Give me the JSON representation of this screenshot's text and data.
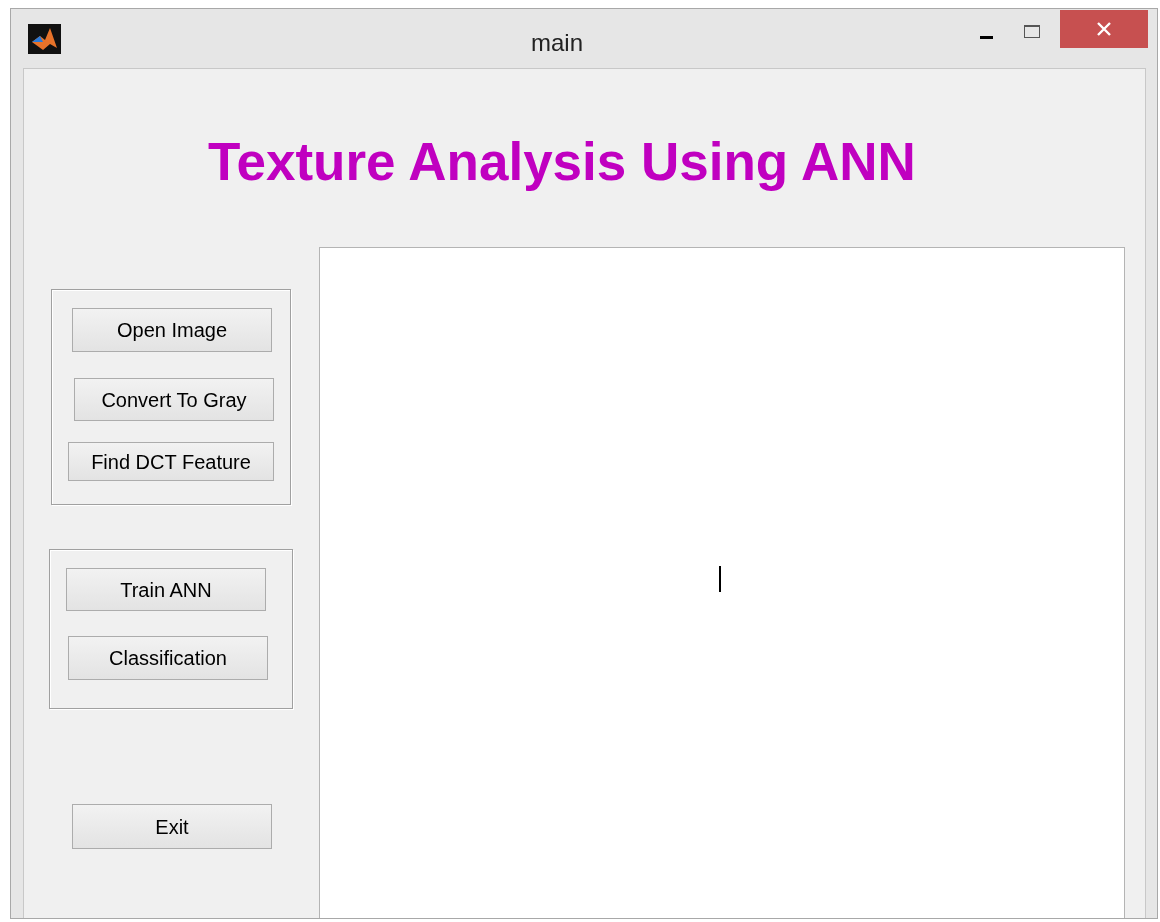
{
  "window": {
    "title": "main"
  },
  "heading": "Texture Analysis Using ANN",
  "button_groups": [
    {
      "buttons": [
        "Open Image",
        "Convert To Gray",
        "Find DCT Feature"
      ]
    },
    {
      "buttons": [
        "Train ANN",
        "Classification"
      ]
    }
  ],
  "exit_button": "Exit"
}
